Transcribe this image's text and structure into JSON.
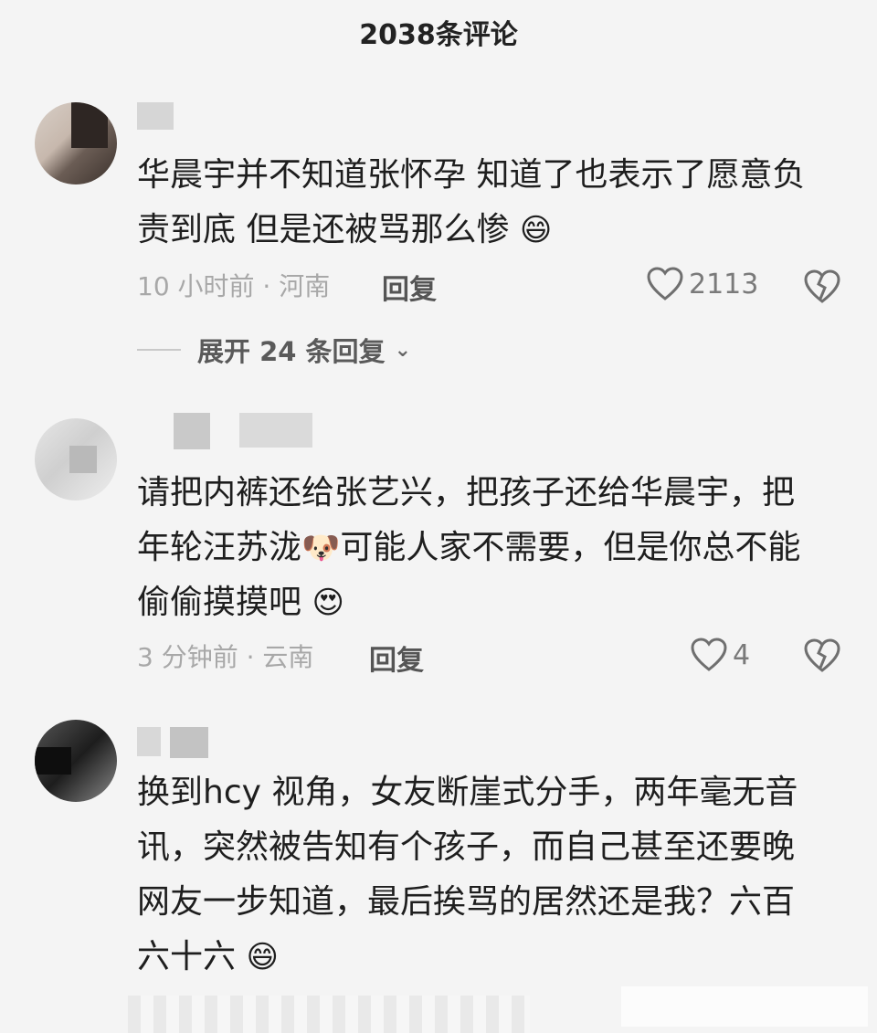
{
  "header": {
    "title": "2038条评论"
  },
  "comments": [
    {
      "username": "",
      "text_line1": "华晨宇并不知道张怀孕 知道了也表示了愿意负",
      "text_line2": "责到底 但是还被骂那么惨",
      "emoji": "😄",
      "time": "10 小时前 · 河南",
      "reply": "回复",
      "likes": "2113",
      "expand": "展开 24 条回复"
    },
    {
      "username": "",
      "text_line1": "请把内裤还给张艺兴，把孩子还给华晨宇，把",
      "text_line2_a": "年轮汪苏泷",
      "emoji_mid": "🐶",
      "text_line2_b": "可能人家不需要，但是你总不能",
      "text_line3": "偷偷摸摸吧",
      "emoji_end": "😍",
      "time": "3 分钟前 · 云南",
      "reply": "回复",
      "likes": "4"
    },
    {
      "username": "",
      "text_line1": "换到hcy 视角，女友断崖式分手，两年毫无音",
      "text_line2": "讯，突然被告知有个孩子，而自己甚至还要晚",
      "text_line3": "网友一步知道，最后挨骂的居然还是我？六百",
      "text_line4": "六十六",
      "emoji": "😄",
      "time_partial": ""
    }
  ],
  "icons": {
    "like": "heart-outline-icon",
    "dislike": "broken-heart-icon",
    "expand": "chevron-down-icon"
  },
  "colors": {
    "background": "#f4f4f4",
    "meta": "#a8a8a8",
    "text": "#1e1e1e"
  }
}
